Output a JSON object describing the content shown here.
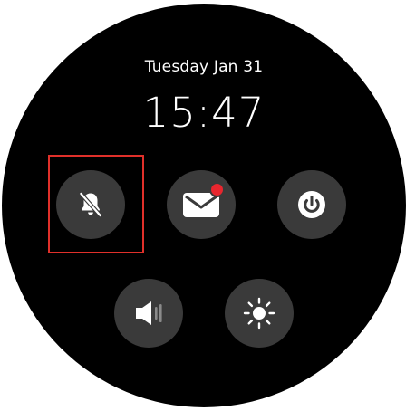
{
  "status": {
    "date": "Tuesday Jan 31",
    "time": "15:47"
  },
  "tiles": [
    {
      "name": "do-not-disturb",
      "icon": "bell-off-icon"
    },
    {
      "name": "messages",
      "icon": "mail-icon",
      "unread_badge": true
    },
    {
      "name": "power",
      "icon": "power-icon"
    },
    {
      "name": "sound",
      "icon": "speaker-icon"
    },
    {
      "name": "brightness",
      "icon": "sun-icon"
    }
  ],
  "colors": {
    "face": "#000000",
    "tile": "#3a3a3a",
    "icon": "#ffffff",
    "badge": "#e8262e",
    "highlight": "#e0302a"
  }
}
